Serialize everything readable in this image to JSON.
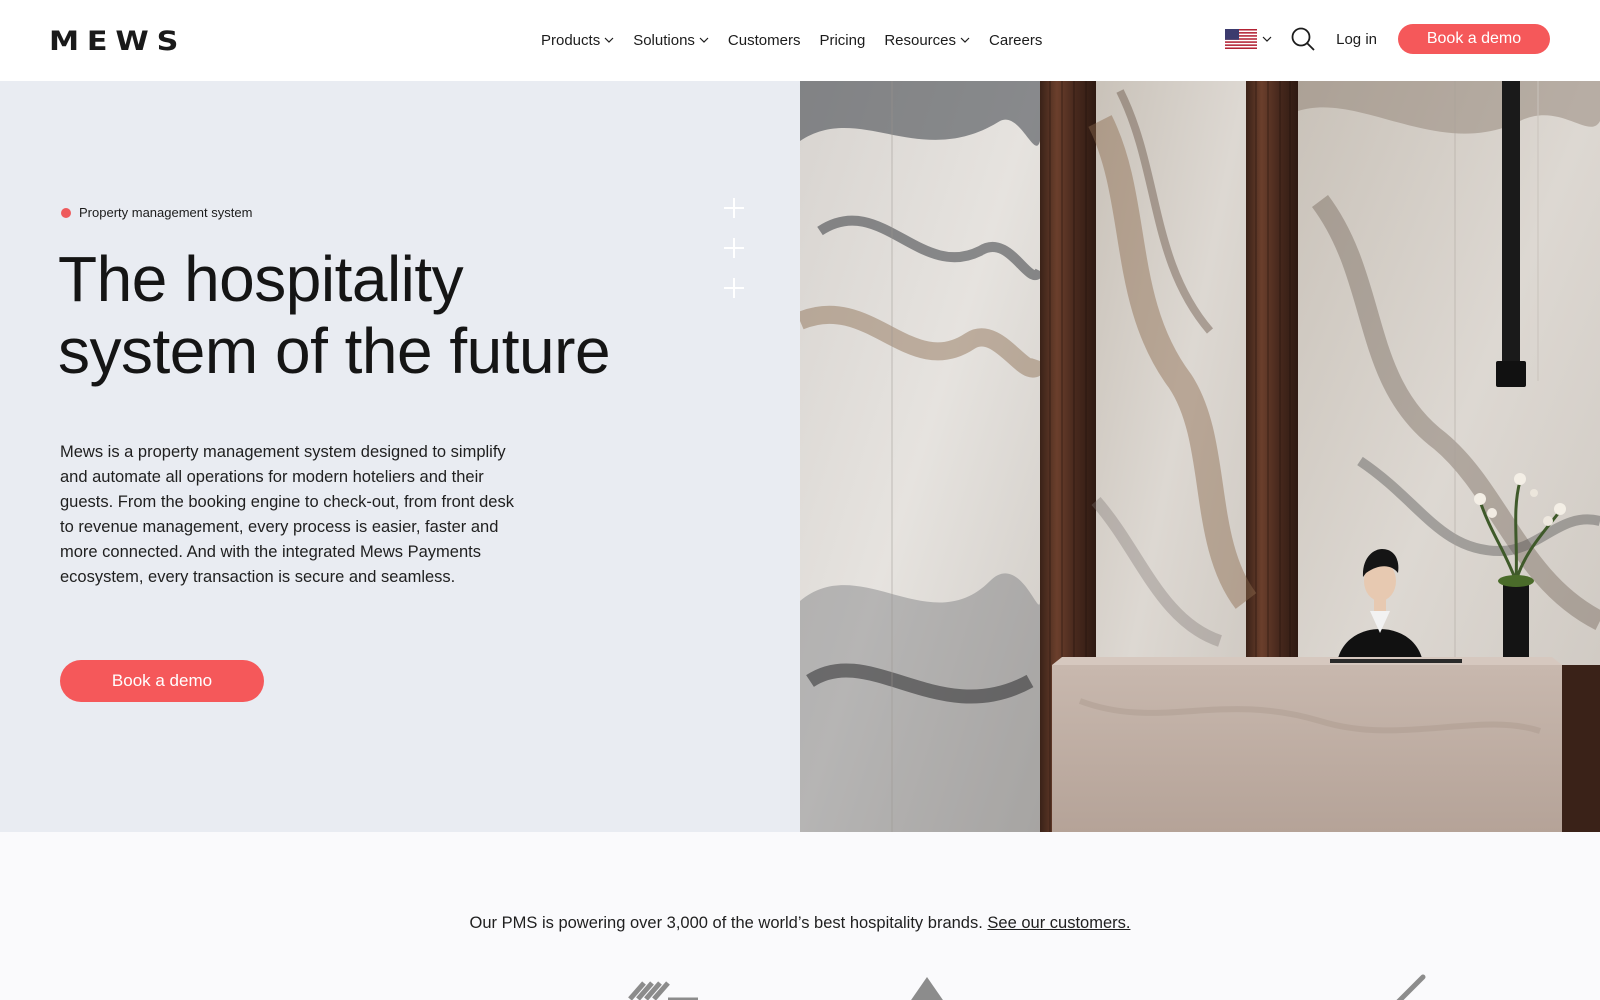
{
  "header": {
    "logo_text": "MEWS",
    "nav": [
      {
        "label": "Products",
        "has_dropdown": true
      },
      {
        "label": "Solutions",
        "has_dropdown": true
      },
      {
        "label": "Customers",
        "has_dropdown": false
      },
      {
        "label": "Pricing",
        "has_dropdown": false
      },
      {
        "label": "Resources",
        "has_dropdown": true
      },
      {
        "label": "Careers",
        "has_dropdown": false
      }
    ],
    "language_flag_icon": "us-flag-icon",
    "search_icon": "search-icon",
    "login_label": "Log in",
    "demo_label": "Book a demo"
  },
  "hero": {
    "eyebrow": "Property management system",
    "title_line1": "The hospitality",
    "title_line2": "system of the future",
    "body": "Mews is a property management system designed to simplify and automate all operations for modern hoteliers and their guests. From the booking engine to check-out, from front desk to revenue management, every process is easier, faster and more connected. And with the integrated Mews Payments ecosystem, every transaction is secure and seamless.",
    "cta_label": "Book a demo"
  },
  "customers": {
    "text": "Our PMS is powering over 3,000 of the world’s best hospitality brands.",
    "link_label": "See our customers."
  },
  "colors": {
    "accent": "#f5585a",
    "hero_bg": "#e9ecf2",
    "text": "#1c1c1c"
  }
}
